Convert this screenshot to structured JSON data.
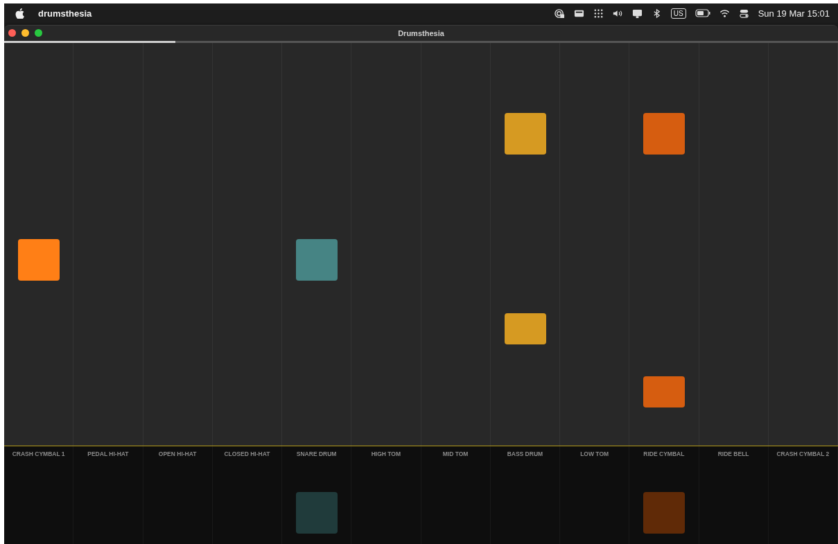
{
  "menu_bar": {
    "app_name": "drumsthesia",
    "keyboard_layout": "US",
    "clock": "Sun 19 Mar  15:01"
  },
  "window": {
    "title": "Drumsthesia"
  },
  "progress": {
    "level": 0.205
  },
  "lanes": [
    {
      "label": "CRASH CYMBAL 1",
      "color": "#ff7f16",
      "notes": [
        {
          "kind": "tall"
        }
      ]
    },
    {
      "label": "PEDAL HI-HAT"
    },
    {
      "label": "OPEN HI-HAT"
    },
    {
      "label": "CLOSED HI-HAT"
    },
    {
      "label": "SNARE DRUM",
      "color": "#468484",
      "notes": [
        {
          "kind": "tall"
        }
      ],
      "pad": true
    },
    {
      "label": "HIGH TOM"
    },
    {
      "label": "MID TOM"
    },
    {
      "label": "BASS DRUM",
      "color": "#d69a22",
      "notes": [
        {
          "kind": "tall"
        },
        {
          "kind": "short"
        }
      ]
    },
    {
      "label": "LOW TOM"
    },
    {
      "label": "RIDE CYMBAL",
      "color": "#d65d10",
      "notes": [
        {
          "kind": "tall"
        },
        {
          "kind": "short"
        }
      ],
      "pad": true
    },
    {
      "label": "RIDE BELL"
    },
    {
      "label": "CRASH CYMBAL 2"
    }
  ]
}
